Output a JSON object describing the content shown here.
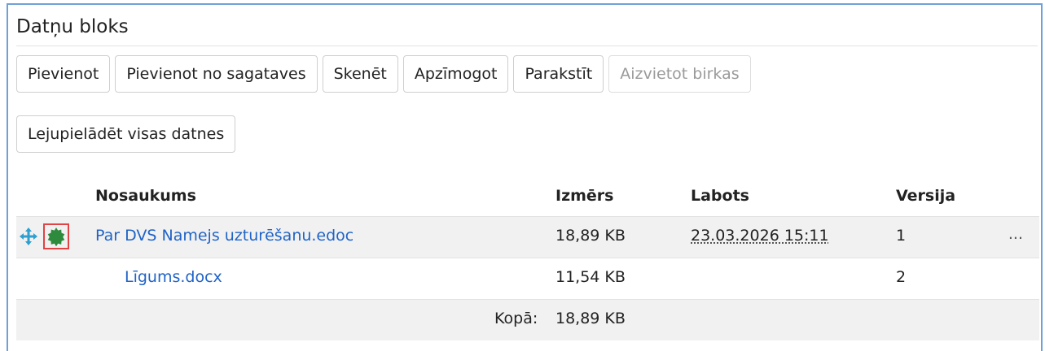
{
  "panel": {
    "title": "Datņu bloks"
  },
  "toolbar": {
    "add": "Pievienot",
    "add_from_template": "Pievienot no sagataves",
    "scan": "Skenēt",
    "stamp": "Apzīmogot",
    "sign": "Parakstīt",
    "replace_tags": "Aizvietot birkas",
    "download_all": "Lejupielādēt visas datnes"
  },
  "table": {
    "headers": {
      "name": "Nosaukums",
      "size": "Izmērs",
      "modified": "Labots",
      "version": "Versija"
    },
    "rows": [
      {
        "name": "Par DVS Namejs uzturēšanu.edoc",
        "size": "18,89 KB",
        "modified": "23.03.2026 15:11",
        "version": "1",
        "menu": "..."
      },
      {
        "name": "Līgums.docx",
        "size": "11,54 KB",
        "modified": "",
        "version": "2"
      }
    ],
    "total_label": "Kopā:",
    "total_value": "18,89 KB"
  },
  "icons": {
    "move": "move-arrows-icon",
    "seal": "seal-icon"
  },
  "colors": {
    "link": "#1f63c6",
    "seal": "#2e8b3e",
    "move": "#2f9fd0",
    "highlight": "#e04444",
    "panel_border": "#6fa0d8"
  }
}
